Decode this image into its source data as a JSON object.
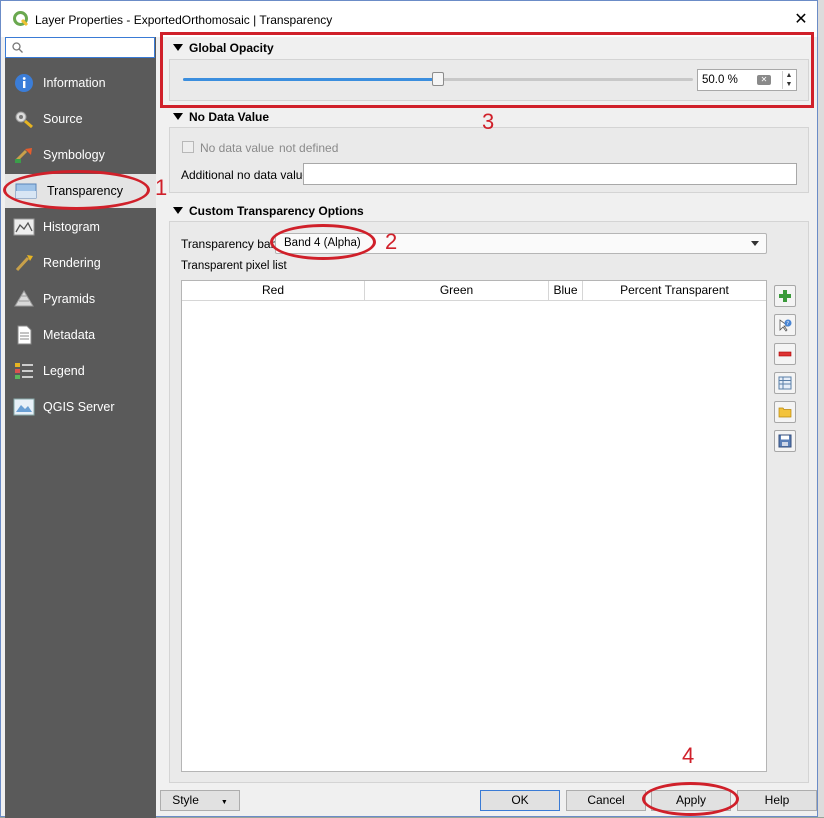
{
  "window": {
    "title": "Layer Properties - ExportedOrthomosaic | Transparency",
    "close_glyph": "✕"
  },
  "search": {
    "value": "",
    "icon": "search-icon"
  },
  "sidebar": {
    "items": [
      {
        "label": "Information",
        "icon": "information-icon"
      },
      {
        "label": "Source",
        "icon": "source-icon"
      },
      {
        "label": "Symbology",
        "icon": "symbology-icon"
      },
      {
        "label": "Transparency",
        "icon": "transparency-icon",
        "active": true
      },
      {
        "label": "Histogram",
        "icon": "histogram-icon"
      },
      {
        "label": "Rendering",
        "icon": "rendering-icon"
      },
      {
        "label": "Pyramids",
        "icon": "pyramids-icon"
      },
      {
        "label": "Metadata",
        "icon": "metadata-icon"
      },
      {
        "label": "Legend",
        "icon": "legend-icon"
      },
      {
        "label": "QGIS Server",
        "icon": "qgis-server-icon"
      }
    ]
  },
  "global_opacity": {
    "header": "Global Opacity",
    "value": 50.0,
    "value_text": "50.0 %"
  },
  "no_data": {
    "header": "No Data Value",
    "checkbox_label": "No data value",
    "checkbox_checked": false,
    "status": "not defined",
    "additional_label": "Additional no data value",
    "additional_value": ""
  },
  "custom": {
    "header": "Custom Transparency Options",
    "band_label": "Transparency band",
    "band_value": "Band 4 (Alpha)",
    "pixel_list_label": "Transparent pixel list",
    "columns": [
      "Red",
      "Green",
      "Blue",
      "Percent Transparent"
    ],
    "rows": []
  },
  "tools": [
    "add-value-icon",
    "add-from-display-icon",
    "remove-value-icon",
    "default-values-icon",
    "import-file-icon",
    "export-file-icon"
  ],
  "footer": {
    "style": "Style",
    "ok": "OK",
    "cancel": "Cancel",
    "apply": "Apply",
    "help": "Help"
  },
  "annotations": [
    "1",
    "2",
    "3",
    "4"
  ],
  "colors": {
    "annotation": "#d0202a",
    "sidebar_bg": "#5a5a5a",
    "slider_fill": "#3b8ede"
  }
}
